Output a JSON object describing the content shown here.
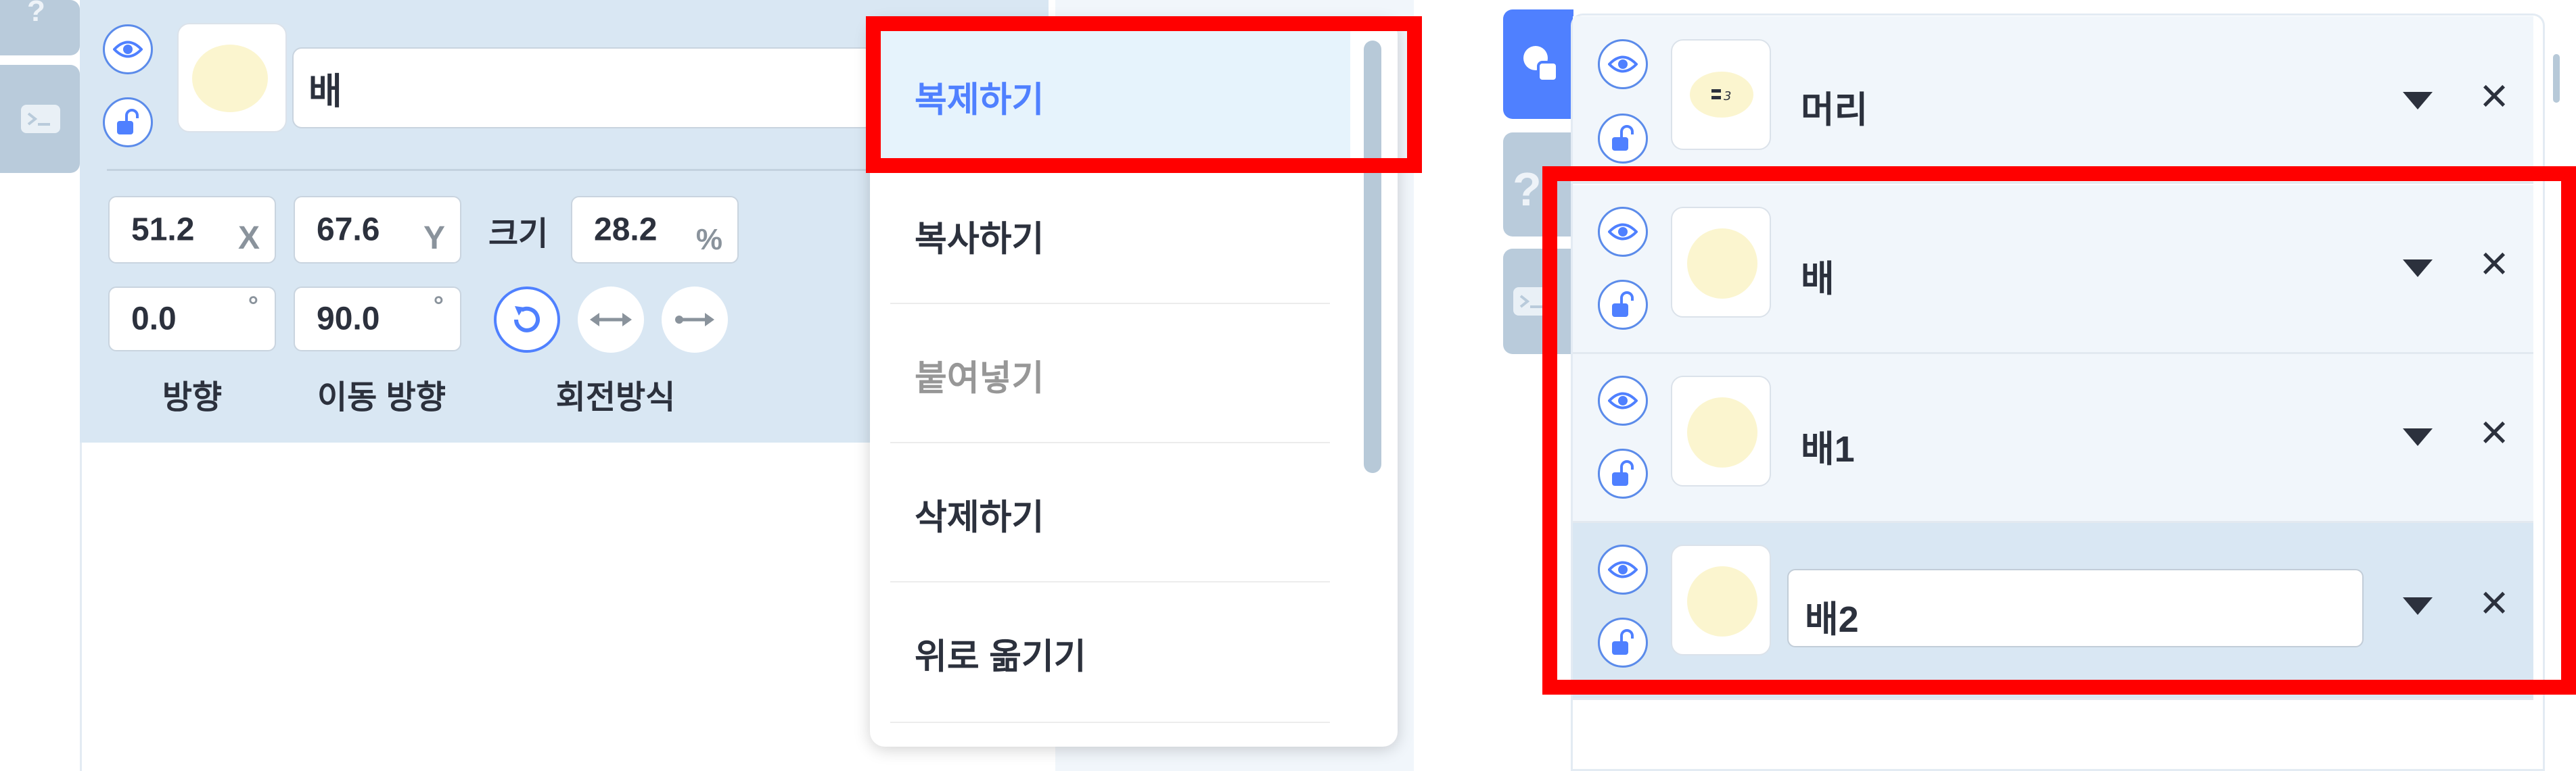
{
  "property_panel": {
    "object_name": "배",
    "x": {
      "value": "51.2",
      "unit": "X"
    },
    "y": {
      "value": "67.6",
      "unit": "Y"
    },
    "size": {
      "label": "크기",
      "value": "28.2",
      "unit": "%"
    },
    "direction": {
      "value": "0.0",
      "unit": "°",
      "label": "방향"
    },
    "move_direction": {
      "value": "90.0",
      "unit": "°",
      "label": "이동 방향"
    },
    "rotation_label": "회전방식"
  },
  "context_menu": {
    "items": [
      {
        "label": "복제하기",
        "state": "highlighted"
      },
      {
        "label": "복사하기",
        "state": "enabled"
      },
      {
        "label": "붙여넣기",
        "state": "disabled"
      },
      {
        "label": "삭제하기",
        "state": "enabled"
      },
      {
        "label": "위로 옮기기",
        "state": "enabled"
      }
    ]
  },
  "object_list": {
    "items": [
      {
        "name": "머리",
        "thumb": "face-sticker"
      },
      {
        "name": "배",
        "thumb": "yellow-circle"
      },
      {
        "name": "배1",
        "thumb": "yellow-circle"
      },
      {
        "name": "배2",
        "thumb": "yellow-circle",
        "editing": true
      }
    ]
  },
  "icons": {
    "visibility": "eye-icon",
    "lock": "lock-open-icon",
    "dropdown": "caret-down-icon",
    "delete": "close-icon",
    "console": "console-icon",
    "help": "question-icon",
    "objects_tab": "shapes-icon"
  },
  "colors": {
    "accent_blue": "#4f80ff",
    "panel_bg": "#d9e7f3",
    "highlight_red": "#ff0000",
    "menu_hover_bg": "#e6f3fc",
    "disabled_text": "#979797"
  }
}
